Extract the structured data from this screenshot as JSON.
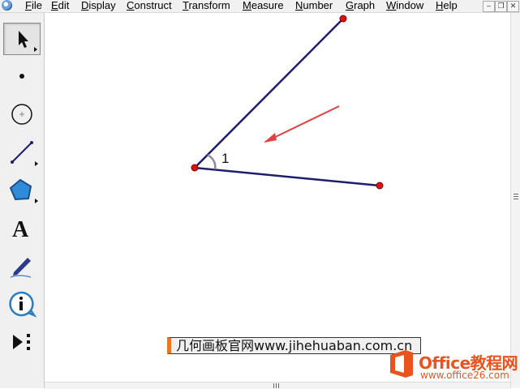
{
  "menu": {
    "items": [
      {
        "key": "F",
        "rest": "ile"
      },
      {
        "key": "E",
        "rest": "dit"
      },
      {
        "key": "D",
        "rest": "isplay"
      },
      {
        "key": "C",
        "rest": "onstruct"
      },
      {
        "key": "T",
        "rest": "ransform"
      },
      {
        "key": "M",
        "rest": "easure"
      },
      {
        "key": "N",
        "rest": "umber"
      },
      {
        "key": "G",
        "rest": "raph"
      },
      {
        "key": "W",
        "rest": "indow"
      },
      {
        "key": "H",
        "rest": "elp"
      }
    ]
  },
  "toolbox": {
    "tools": [
      {
        "name": "arrow-selection-tool-icon",
        "selected": true
      },
      {
        "name": "point-tool-icon",
        "selected": false
      },
      {
        "name": "compass-tool-icon",
        "selected": false
      },
      {
        "name": "straightedge-tool-icon",
        "selected": false
      },
      {
        "name": "polygon-tool-icon",
        "selected": false
      },
      {
        "name": "text-tool-icon",
        "selected": false
      },
      {
        "name": "marker-tool-icon",
        "selected": false
      },
      {
        "name": "information-tool-icon",
        "selected": false
      },
      {
        "name": "custom-tools-icon",
        "selected": false
      }
    ],
    "text_tool_glyph": "A"
  },
  "canvas": {
    "angle_label": "1",
    "colors": {
      "segment": "#1b1f6e",
      "point": "#e01010",
      "arrow": "#e0403f",
      "angle_marker": "#8a8a9a"
    }
  },
  "caption": {
    "text": "几何画板官网www.jihehuaban.com.cn"
  },
  "logo": {
    "brand": "Office教程网",
    "url": "www.office26.com",
    "color": "#e8531e"
  }
}
